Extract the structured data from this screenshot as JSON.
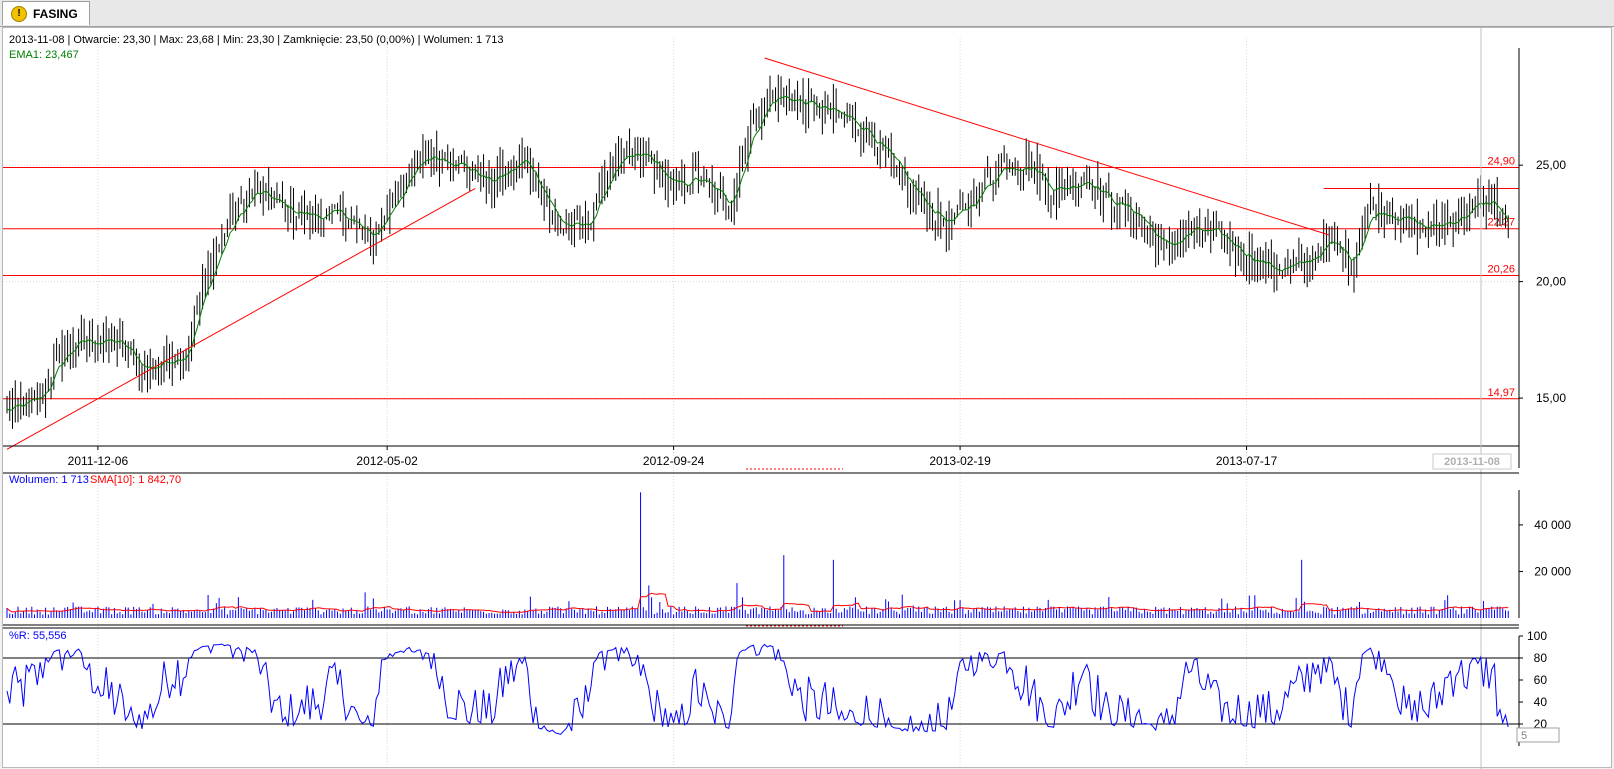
{
  "tab": {
    "title": "FASING",
    "icon": "warning-icon"
  },
  "info": {
    "price_line": "2013-11-08 | Otwarcie: 23,30 | Max: 23,68 | Min: 23,30 | Zamknięcie: 23,50 (0,00%)  | Wolumen: 1 713",
    "ema_line": "EMA1: 23,467",
    "volume_line": "Wolumen: 1 713",
    "sma_line": "SMA[10]: 1 842,70",
    "wr_line": "%R: 55,556"
  },
  "colors": {
    "price": "#000000",
    "ema": "#008000",
    "line": "#ff0000",
    "volume": "#0000ff",
    "sma": "#ff0000",
    "wr": "#0000ff",
    "grid": "#d0d0d0"
  },
  "scroll_value": "5",
  "chart_data": [
    {
      "type": "ohlc",
      "panel": "price",
      "series_name": "",
      "indicator": "EMA1: 23,467",
      "ylim": [
        13.2,
        29.6
      ],
      "yticks": [
        "15,00",
        "20,00",
        "25,00"
      ],
      "ytick_values": [
        15,
        20,
        25
      ],
      "x_labels": [
        "2011-12-06",
        "2012-05-02",
        "2012-09-24",
        "2013-02-19",
        "2013-07-17"
      ],
      "current_date": "2013-11-08",
      "horizontal_levels": [
        {
          "value": 24.9,
          "label": "24,90"
        },
        {
          "value": 22.27,
          "label": "22,27"
        },
        {
          "value": 20.26,
          "label": "20,26"
        },
        {
          "value": 14.97,
          "label": "14,97"
        }
      ],
      "resistance_segment_value": 24.0,
      "trendlines": [
        {
          "from": {
            "bar": 0,
            "value": 12.8
          },
          "to": {
            "bar": 170,
            "value": 24.0
          }
        },
        {
          "from": {
            "bar": 275,
            "value": 29.6
          },
          "to": {
            "bar": 480,
            "value": 22.0
          }
        }
      ],
      "anchors": [
        [
          0,
          14.4
        ],
        [
          12,
          15.0
        ],
        [
          18,
          16.6
        ],
        [
          25,
          17.5
        ],
        [
          40,
          17.4
        ],
        [
          50,
          16.1
        ],
        [
          58,
          16.7
        ],
        [
          65,
          17.0
        ],
        [
          70,
          19.5
        ],
        [
          80,
          22.5
        ],
        [
          90,
          24.0
        ],
        [
          100,
          23.1
        ],
        [
          110,
          22.8
        ],
        [
          122,
          22.9
        ],
        [
          132,
          21.7
        ],
        [
          142,
          24.0
        ],
        [
          152,
          25.5
        ],
        [
          162,
          25.2
        ],
        [
          175,
          24.2
        ],
        [
          188,
          25.3
        ],
        [
          200,
          22.3
        ],
        [
          210,
          22.3
        ],
        [
          220,
          25.2
        ],
        [
          232,
          25.4
        ],
        [
          242,
          23.9
        ],
        [
          250,
          24.5
        ],
        [
          262,
          23.2
        ],
        [
          270,
          26.8
        ],
        [
          278,
          28.1
        ],
        [
          290,
          27.6
        ],
        [
          300,
          27.2
        ],
        [
          312,
          26.5
        ],
        [
          322,
          24.8
        ],
        [
          332,
          23.3
        ],
        [
          342,
          22.4
        ],
        [
          352,
          23.8
        ],
        [
          362,
          25.2
        ],
        [
          372,
          24.9
        ],
        [
          380,
          23.8
        ],
        [
          392,
          24.5
        ],
        [
          400,
          23.4
        ],
        [
          410,
          22.9
        ],
        [
          420,
          21.3
        ],
        [
          430,
          22.3
        ],
        [
          440,
          21.9
        ],
        [
          450,
          21.1
        ],
        [
          460,
          20.5
        ],
        [
          470,
          20.7
        ],
        [
          480,
          21.8
        ],
        [
          488,
          20.8
        ],
        [
          495,
          23.3
        ],
        [
          505,
          22.8
        ],
        [
          515,
          22.2
        ],
        [
          525,
          22.7
        ],
        [
          535,
          23.4
        ],
        [
          540,
          23.4
        ],
        [
          545,
          22.0
        ]
      ]
    },
    {
      "type": "bar",
      "panel": "volume",
      "series": [
        {
          "name": "Wolumen"
        },
        {
          "name": "SMA[10]"
        }
      ],
      "ylim": [
        0,
        55000
      ],
      "yticks": [
        "20 000",
        "40 000"
      ],
      "ytick_values": [
        20000,
        40000
      ],
      "spikes": [
        [
          230,
          54000
        ],
        [
          233,
          14000
        ],
        [
          265,
          15000
        ],
        [
          282,
          27000
        ],
        [
          300,
          25000
        ],
        [
          470,
          25000
        ],
        [
          130,
          11000
        ],
        [
          325,
          10000
        ],
        [
          400,
          9000
        ]
      ]
    },
    {
      "type": "line",
      "panel": "williams",
      "series": [
        {
          "name": "%R"
        }
      ],
      "ylim": [
        0,
        100
      ],
      "yticks": [
        "20",
        "40",
        "60",
        "80",
        "100"
      ],
      "ytick_values": [
        20,
        40,
        60,
        80,
        100
      ],
      "levels": [
        20,
        80
      ]
    }
  ]
}
